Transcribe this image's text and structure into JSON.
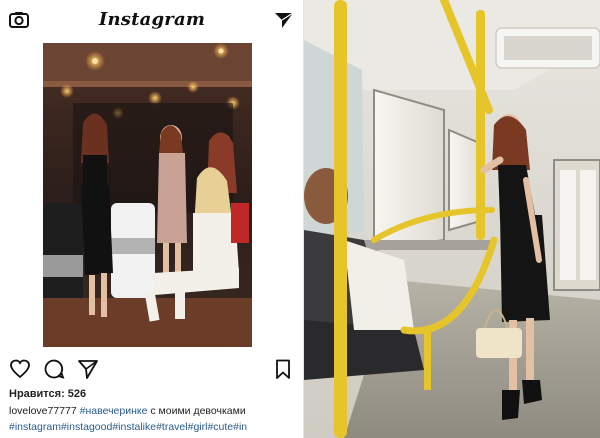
{
  "header": {
    "logo_text": "Instagram",
    "camera_icon": "camera-icon",
    "send_icon": "send-icon"
  },
  "post": {
    "photo_description_icon": "photo",
    "actions": {
      "like_icon": "heart-icon",
      "comment_icon": "comment-icon",
      "share_icon": "share-icon",
      "save_icon": "bookmark-icon"
    },
    "likes_text": "Нравится: 526",
    "username": "lovelove77777",
    "caption_tag": "#навечеринке",
    "caption_text": " с моими девочками",
    "hashtags": "#instagram#instagood#instalike#travel#girl#cute#in"
  },
  "colors": {
    "hashtag": "#2a5a8c",
    "bus_interior": "#d9d6cf",
    "handrail": "#e6c52a"
  }
}
